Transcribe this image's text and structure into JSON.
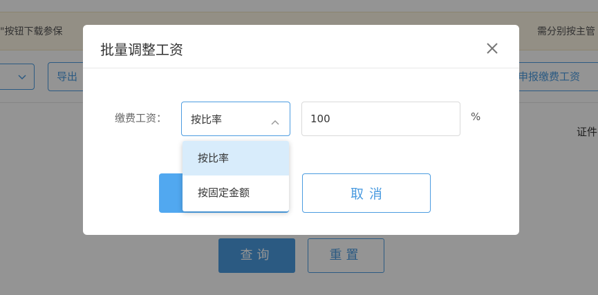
{
  "background": {
    "notice_left": "\"按钮下载参保",
    "notice_right": "需分别按主管",
    "select_chevron": "chevron-down-icon",
    "export_button": "导出",
    "declare_button": "申报缴费工资",
    "id_label": "证件",
    "query_button": "查询",
    "reset_button": "重置"
  },
  "modal": {
    "title": "批量调整工资",
    "close_icon": "close-icon",
    "field_label": "缴费工资：",
    "rate_select": {
      "value": "按比率",
      "chevron": "chevron-up-icon",
      "options": [
        "按比率",
        "按固定金额"
      ],
      "selected_index": 0
    },
    "amount_input": {
      "value": "100"
    },
    "unit": "%",
    "cancel_button": "取消"
  },
  "colors": {
    "accent": "#4a9be0",
    "confirm_fill": "#51a8f0",
    "option_highlight": "#d8ecfb",
    "notice_bg": "#fdf6e6"
  }
}
